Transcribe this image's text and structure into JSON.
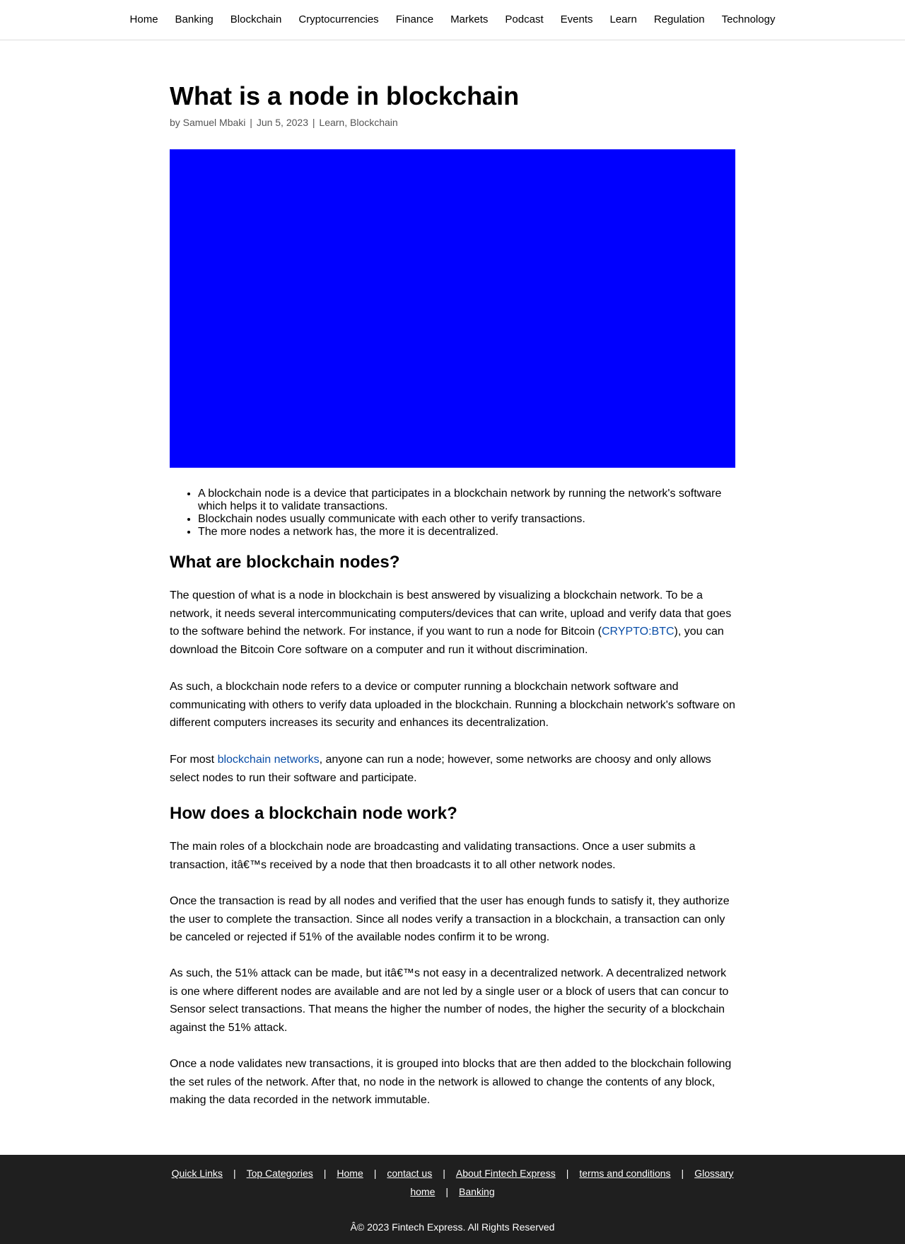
{
  "nav": {
    "items": [
      "Home",
      "Banking",
      "Blockchain",
      "Cryptocurrencies",
      "Finance",
      "Markets",
      "Podcast",
      "Events",
      "Learn",
      "Regulation",
      "Technology"
    ]
  },
  "article": {
    "title": "What is a node in blockchain",
    "meta": {
      "by": "by Samuel Mbaki",
      "sep": "|",
      "date": "Jun 5, 2023",
      "categories": "Learn, Blockchain"
    },
    "bullets": [
      "A blockchain node is a device that participates in a blockchain network by running the network's software which helps it to validate transactions.",
      "Blockchain nodes usually communicate with each other to verify transactions.",
      "The more nodes a network has, the more it is decentralized."
    ],
    "section1": {
      "heading": "What are blockchain nodes?",
      "p1_before": "The question of what is a node in blockchain is best answered by visualizing a blockchain network. To be a network, it needs several intercommunicating computers/devices that can write, upload and verify data that goes to the software behind the network. For instance, if you want to run a node for Bitcoin (",
      "p1_link": "CRYPTO:BTC",
      "p1_after": "), you can download the Bitcoin Core software on a computer and run it without discrimination.",
      "p2": "As such, a blockchain node refers to a device or computer running a blockchain network software and communicating with others to verify data uploaded in the blockchain. Running a blockchain network's software on different computers increases its security and enhances its decentralization.",
      "p3_before": "For most ",
      "p3_link": "blockchain networks",
      "p3_after": ", anyone can run a node; however, some networks are choosy and only allows select nodes to run their software and participate."
    },
    "section2": {
      "heading": "How does a blockchain node work?",
      "p1": "The main roles of a blockchain node are broadcasting and validating transactions. Once a user submits a transaction, itâ€™s received by a node that then broadcasts it to all other network nodes.",
      "p2": "Once the transaction is read by all nodes and verified that the user has enough funds to satisfy it, they authorize the user to complete the transaction. Since all nodes verify a transaction in a blockchain, a transaction can only be canceled or rejected if 51% of the available nodes confirm it to be wrong.",
      "p3": "As such, the 51% attack can be made, but itâ€™s not easy in a decentralized network. A decentralized network is one where different nodes are available and are not led by a single user or a block of users that can concur to Sensor select transactions. That means the higher the number of nodes, the higher the security of a blockchain against the 51% attack.",
      "p4": "Once a node validates new transactions, it is grouped into blocks that are then added to the blockchain following the set rules of the network. After that, no node in the network is allowed to change the contents of any block, making the data recorded in the network immutable."
    }
  },
  "footer": {
    "row1": [
      "Quick Links",
      "Top Categories",
      "Home",
      "contact us",
      "About Fintech Express",
      "terms and conditions",
      "Glossary"
    ],
    "row2": [
      "home",
      "Banking"
    ],
    "separator": "|",
    "copyright": "Â© 2023 Fintech Express. All Rights Reserved"
  },
  "colors": {
    "hero": "#0000ff",
    "link": "#0a4ea8",
    "footer_bg": "#1f1f1f"
  }
}
